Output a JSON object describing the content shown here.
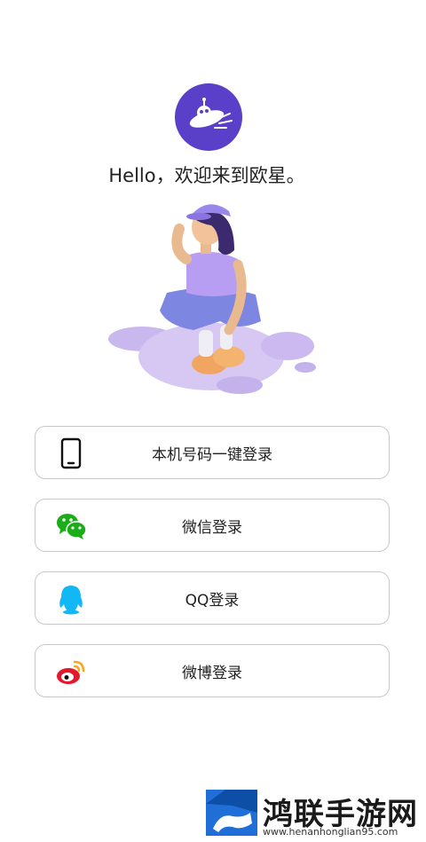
{
  "app": {
    "greeting": "Hello，欢迎来到欧星。",
    "logo_icon": "ufo-planet-icon",
    "brand_color": "#5a3fc9"
  },
  "login_options": [
    {
      "label": "本机号码一键登录",
      "icon": "phone-icon"
    },
    {
      "label": "微信登录",
      "icon": "wechat-icon",
      "color": "#1aad19"
    },
    {
      "label": "QQ登录",
      "icon": "qq-icon",
      "color": "#12b7f5"
    },
    {
      "label": "微博登录",
      "icon": "weibo-icon",
      "color": "#e6162d"
    }
  ],
  "watermark": {
    "title": "鸿联手游网",
    "url": "www.henanhonglian95.com"
  }
}
